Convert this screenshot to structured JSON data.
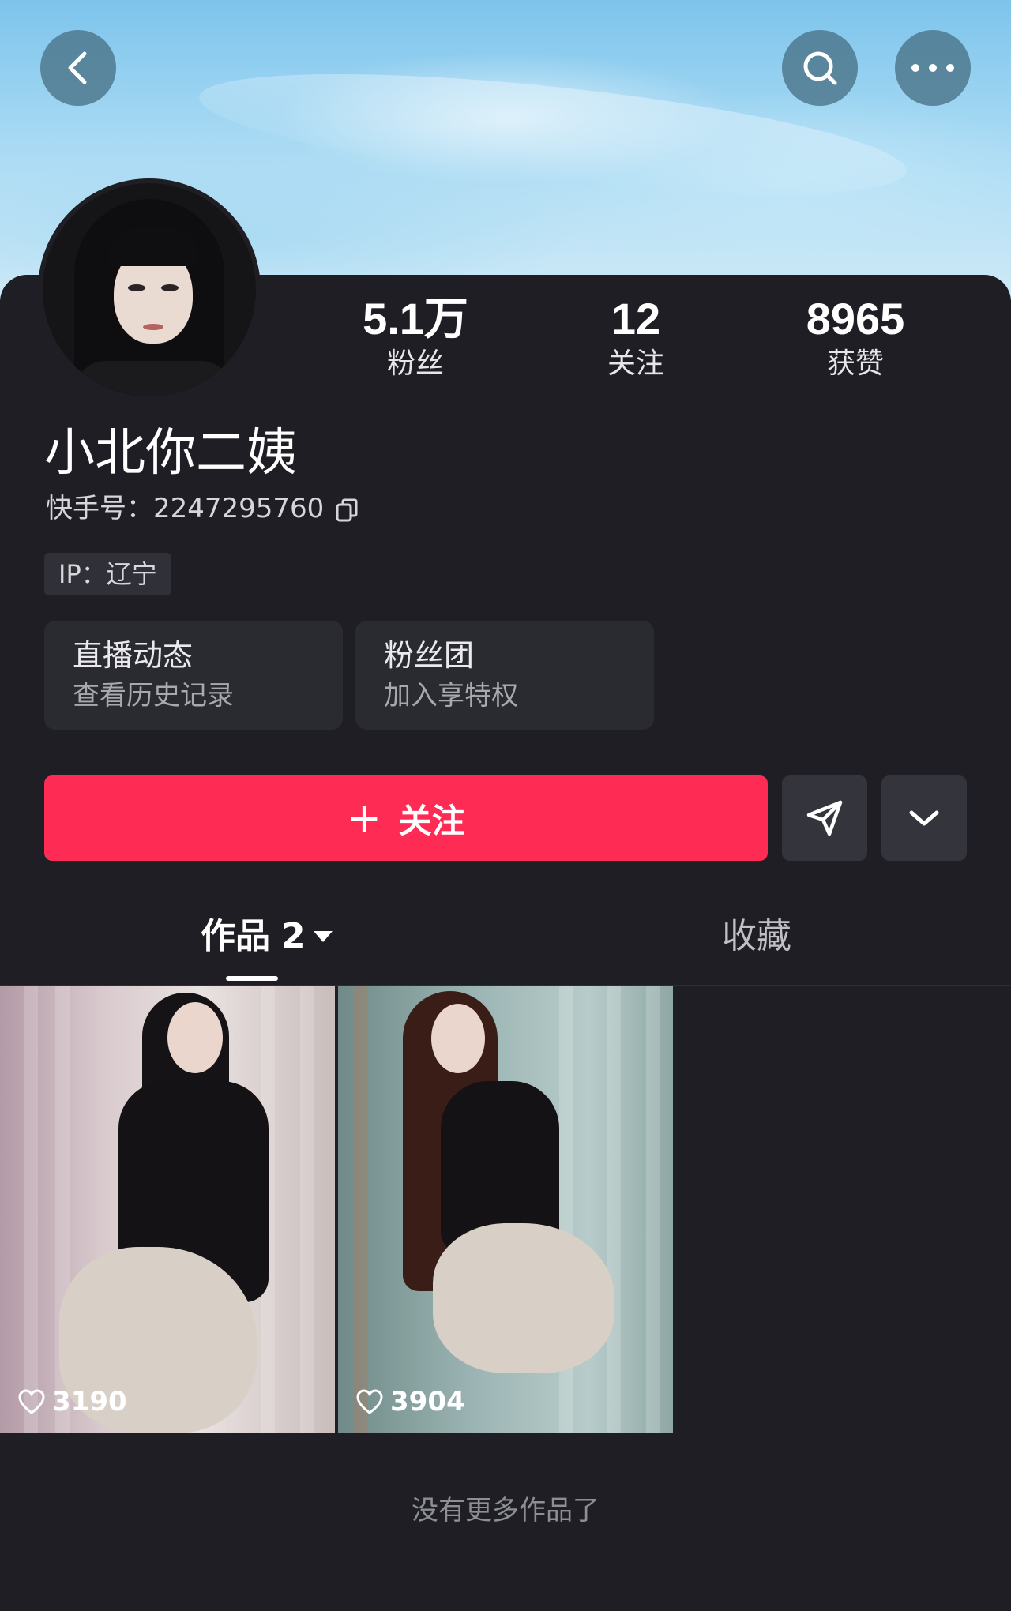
{
  "header": {
    "back_icon": "chevron-left-icon",
    "search_icon": "search-icon",
    "more_icon": "more-dots-icon"
  },
  "profile": {
    "username": "小北你二姨",
    "account_id": "快手号：2247295760",
    "ip": "IP：辽宁",
    "stats": [
      {
        "value": "5.1万",
        "label": "粉丝"
      },
      {
        "value": "12",
        "label": "关注"
      },
      {
        "value": "8965",
        "label": "获赞"
      }
    ]
  },
  "cards": [
    {
      "title": "直播动态",
      "subtitle": "查看历史记录"
    },
    {
      "title": "粉丝团",
      "subtitle": "加入享特权"
    }
  ],
  "actions": {
    "follow_plus": "+",
    "follow_label": "关注",
    "share_icon": "send-icon",
    "expand_icon": "chevron-down-icon"
  },
  "tabs": {
    "works_label": "作品",
    "works_count": "2",
    "favorites_label": "收藏"
  },
  "works": [
    {
      "likes": "3190"
    },
    {
      "likes": "3904"
    }
  ],
  "footer": {
    "no_more": "没有更多作品了"
  },
  "colors": {
    "accent": "#fe2c55",
    "background": "#1e1e24",
    "card": "#2a2a31"
  }
}
